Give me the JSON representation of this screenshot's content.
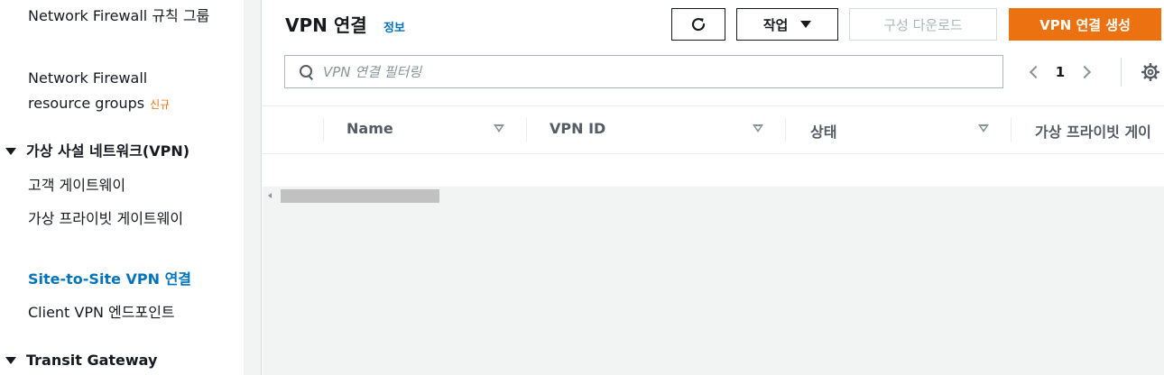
{
  "sidebar": {
    "items": [
      {
        "label": "Network Firewall 규칙 그룹"
      },
      {
        "label": "Network Firewall resource groups",
        "badge": "신규"
      },
      {
        "label": "고객 게이트웨이"
      },
      {
        "label": "가상 프라이빗 게이트웨이"
      },
      {
        "label": "Site-to-Site VPN 연결",
        "active": true
      },
      {
        "label": "Client VPN 엔드포인트"
      }
    ],
    "sections": [
      {
        "label": "가상 사설 네트워크(VPN)",
        "expanded": true
      },
      {
        "label": "Transit Gateway",
        "expanded": true
      }
    ]
  },
  "header": {
    "title": "VPN 연결",
    "info_link": "정보",
    "buttons": {
      "actions": "작업",
      "download_config": "구성 다운로드",
      "create": "VPN 연결 생성"
    }
  },
  "search": {
    "placeholder": "VPN 연결 필터링",
    "value": ""
  },
  "pagination": {
    "current_page": "1"
  },
  "table": {
    "columns": [
      "Name",
      "VPN ID",
      "상태",
      "가상 프라이빗 게이"
    ],
    "rows": []
  },
  "colors": {
    "primary": "#ec7211",
    "link": "#0073bb",
    "text": "#16191f",
    "muted": "#879596"
  },
  "icons": {
    "refresh": "refresh-icon",
    "actions_caret": "caret-down-icon",
    "search": "search-icon",
    "prev": "chevron-left-icon",
    "next": "chevron-right-icon",
    "settings": "gear-icon"
  }
}
